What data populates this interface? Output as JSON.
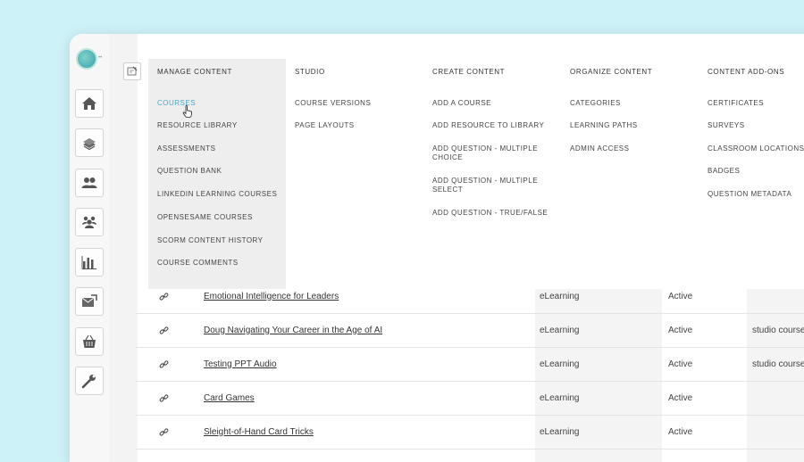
{
  "menu": {
    "columns": [
      {
        "heading": "MANAGE CONTENT",
        "items": [
          "COURSES",
          "RESOURCE LIBRARY",
          "ASSESSMENTS",
          "QUESTION BANK",
          "LINKEDIN LEARNING COURSES",
          "OPENSESAME COURSES",
          "SCORM CONTENT HISTORY",
          "COURSE COMMENTS"
        ]
      },
      {
        "heading": "STUDIO",
        "items": [
          "COURSE VERSIONS",
          "PAGE LAYOUTS"
        ]
      },
      {
        "heading": "CREATE CONTENT",
        "items": [
          "ADD A COURSE",
          "ADD RESOURCE TO LIBRARY",
          "ADD QUESTION - MULTIPLE CHOICE",
          "ADD QUESTION - MULTIPLE SELECT",
          "ADD QUESTION - TRUE/FALSE"
        ]
      },
      {
        "heading": "ORGANIZE CONTENT",
        "items": [
          "CATEGORIES",
          "LEARNING PATHS",
          "ADMIN ACCESS"
        ]
      },
      {
        "heading": "CONTENT ADD-ONS",
        "items": [
          "CERTIFICATES",
          "SURVEYS",
          "CLASSROOM LOCATIONS",
          "BADGES",
          "QUESTION METADATA"
        ]
      }
    ],
    "active_item": "COURSES"
  },
  "sidebar": {
    "icons": [
      "home-icon",
      "courses-icon",
      "users-icon",
      "groups-icon",
      "reports-icon",
      "messages-icon",
      "store-icon",
      "tools-icon"
    ]
  },
  "table": {
    "rows": [
      {
        "title": "Emotional Intelligence for Leaders",
        "type": "eLearning",
        "status": "Active",
        "extra": ""
      },
      {
        "title": "Doug Navigating Your Career in the Age of AI",
        "type": "eLearning",
        "status": "Active",
        "extra": "studio course"
      },
      {
        "title": "Testing PPT Audio",
        "type": "eLearning",
        "status": "Active",
        "extra": "studio course"
      },
      {
        "title": "Card Games",
        "type": "eLearning",
        "status": "Active",
        "extra": ""
      },
      {
        "title": "Sleight-of-Hand Card Tricks",
        "type": "eLearning",
        "status": "Active",
        "extra": ""
      }
    ]
  }
}
